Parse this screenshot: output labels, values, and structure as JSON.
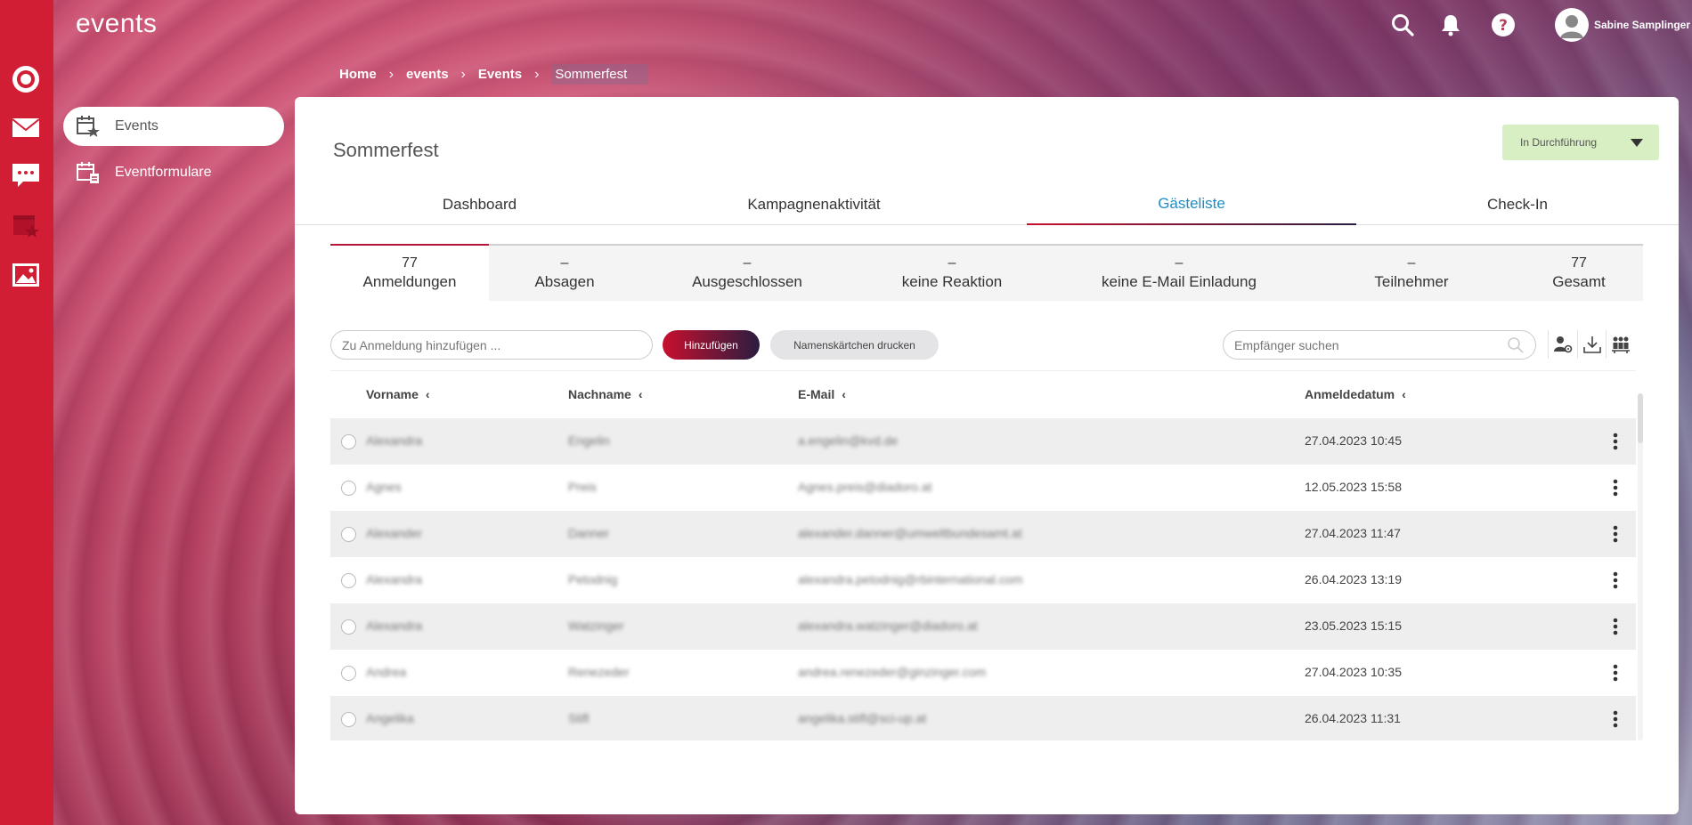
{
  "app": {
    "title": "events"
  },
  "user": {
    "name": "Sabine Samplinger"
  },
  "sidebar": {
    "items": [
      {
        "label": "Events",
        "active": true
      },
      {
        "label": "Eventformulare",
        "active": false
      }
    ]
  },
  "breadcrumb": [
    "Home",
    "events",
    "Events",
    "Sommerfest"
  ],
  "page": {
    "title": "Sommerfest"
  },
  "status": {
    "selected": "In Durchführung",
    "color": "#d8efc3"
  },
  "tabs": [
    {
      "label": "Dashboard"
    },
    {
      "label": "Kampagnenaktivität"
    },
    {
      "label": "Gästeliste",
      "active": true
    },
    {
      "label": "Check-In"
    }
  ],
  "stats": [
    {
      "value": "77",
      "label": "Anmeldungen",
      "active": true
    },
    {
      "value": "–",
      "label": "Absagen"
    },
    {
      "value": "–",
      "label": "Ausgeschlossen"
    },
    {
      "value": "–",
      "label": "keine Reaktion"
    },
    {
      "value": "–",
      "label": "keine E-Mail Einladung"
    },
    {
      "value": "–",
      "label": "Teilnehmer"
    },
    {
      "value": "77",
      "label": "Gesamt"
    }
  ],
  "toolbar": {
    "add_placeholder": "Zu Anmeldung hinzufügen ...",
    "add_label": "Hinzufügen",
    "print_label": "Namenskärtchen drucken",
    "search_placeholder": "Empfänger suchen"
  },
  "table": {
    "columns": [
      "Vorname",
      "Nachname",
      "E-Mail",
      "Anmeldedatum"
    ],
    "rows": [
      {
        "first": "Alexandra",
        "last": "Engelin",
        "email": "a.engelin@kvd.de",
        "date": "27.04.2023 10:45"
      },
      {
        "first": "Agnes",
        "last": "Preis",
        "email": "Agnes.preis@diadoro.at",
        "date": "12.05.2023 15:58"
      },
      {
        "first": "Alexander",
        "last": "Danner",
        "email": "alexander.danner@umweltbundesamt.at",
        "date": "27.04.2023 11:47"
      },
      {
        "first": "Alexandra",
        "last": "Petodnig",
        "email": "alexandra.petodnig@rbinternational.com",
        "date": "26.04.2023 13:19"
      },
      {
        "first": "Alexandra",
        "last": "Watzinger",
        "email": "alexandra.watzinger@diadoro.at",
        "date": "23.05.2023 15:15"
      },
      {
        "first": "Andrea",
        "last": "Renezeder",
        "email": "andrea.renezeder@ginzinger.com",
        "date": "27.04.2023 10:35"
      },
      {
        "first": "Angelika",
        "last": "Stifl",
        "email": "angelika.stifl@sci-up.at",
        "date": "26.04.2023 11:31"
      }
    ]
  },
  "colors": {
    "brand_red": "#d11e34",
    "tab_active": "#1e8dc3",
    "accent_dark": "#2a1d3f"
  }
}
